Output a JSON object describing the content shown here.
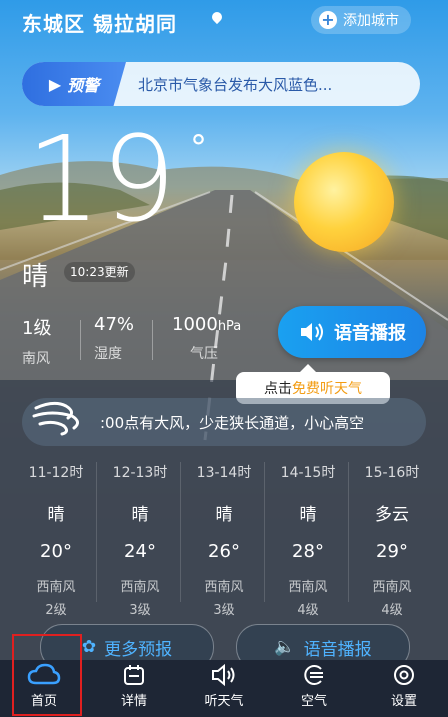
{
  "header": {
    "location": "东城区 锡拉胡同",
    "add_city_label": "添加城市"
  },
  "alert": {
    "tag": "预警",
    "message": "北京市气象台发布大风蓝色..."
  },
  "current": {
    "temperature": "19",
    "degree_symbol": "°",
    "condition": "晴",
    "update_time": "10:23更新",
    "wind_level": "1级",
    "wind_direction": "南风",
    "humidity": "47%",
    "humidity_label": "湿度",
    "pressure_value": "1000",
    "pressure_unit": "hPa",
    "pressure_label": "气压"
  },
  "voice_button_label": "语音播报",
  "tip": {
    "prefix": "点击",
    "highlight": "免费听天气"
  },
  "wind_banner": ":00点有大风，少走狭长通道，小心高空",
  "hourly": [
    {
      "time": "11-12时",
      "cond": "晴",
      "temp": "20°",
      "wind": "西南风",
      "level": "2级"
    },
    {
      "time": "12-13时",
      "cond": "晴",
      "temp": "24°",
      "wind": "西南风",
      "level": "3级"
    },
    {
      "time": "13-14时",
      "cond": "晴",
      "temp": "26°",
      "wind": "西南风",
      "level": "3级"
    },
    {
      "time": "14-15时",
      "cond": "晴",
      "temp": "28°",
      "wind": "西南风",
      "level": "4级"
    },
    {
      "time": "15-16时",
      "cond": "多云",
      "temp": "29°",
      "wind": "西南风",
      "level": "4级"
    }
  ],
  "actions": {
    "more_forecast": "更多预报",
    "voice_report": "语音播报"
  },
  "tabs": [
    {
      "label": "首页",
      "icon": "cloud-icon"
    },
    {
      "label": "详情",
      "icon": "calendar-icon"
    },
    {
      "label": "听天气",
      "icon": "speaker-icon"
    },
    {
      "label": "空气",
      "icon": "air-icon"
    },
    {
      "label": "设置",
      "icon": "settings-icon"
    }
  ],
  "colors": {
    "accent": "#1d84e6",
    "alert_blue": "#2f6fe0",
    "highlight_orange": "#f39c12",
    "tabbar": "#1e2635"
  }
}
